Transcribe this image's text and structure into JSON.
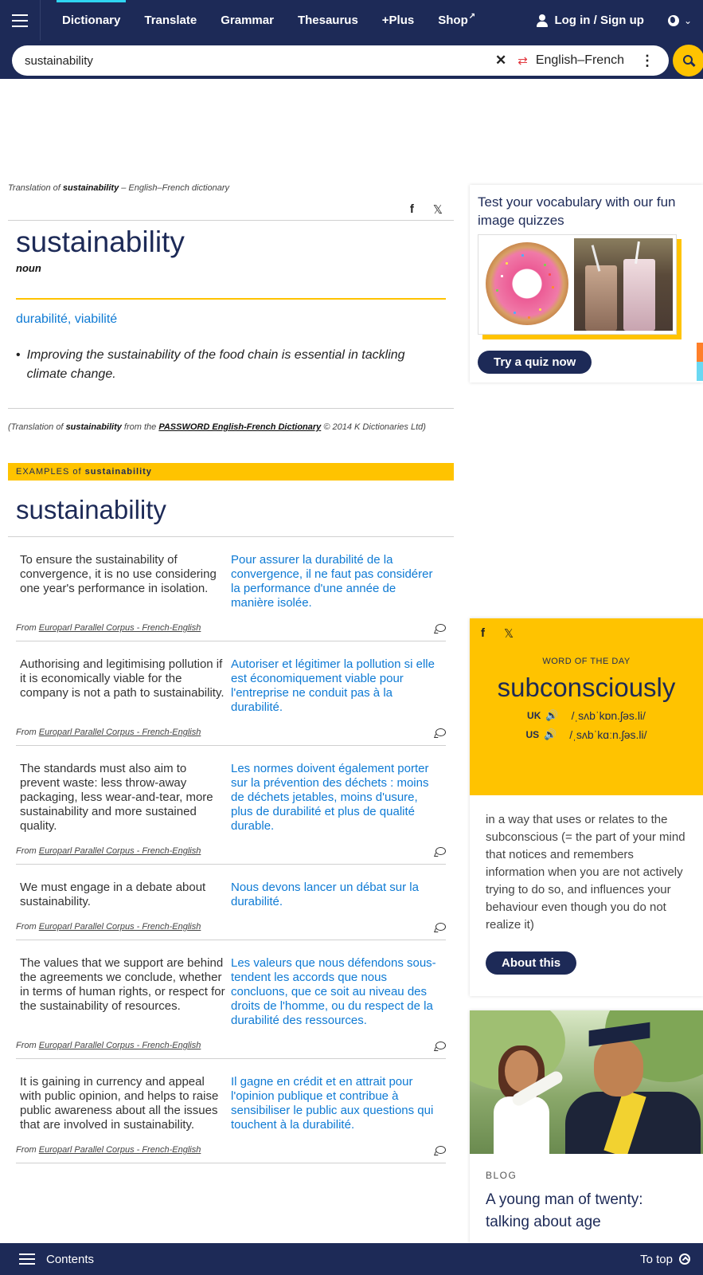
{
  "nav": {
    "items": [
      {
        "label": "Dictionary",
        "active": true
      },
      {
        "label": "Translate"
      },
      {
        "label": "Grammar"
      },
      {
        "label": "Thesaurus"
      },
      {
        "label": "+Plus"
      },
      {
        "label": "Shop"
      }
    ],
    "login_label": "Log in / Sign up",
    "icons": {
      "menu": "hamburger-icon",
      "user": "user-icon",
      "globe": "globe-icon",
      "external": "external-link-icon"
    }
  },
  "search": {
    "value": "sustainability",
    "language": "English–French",
    "icons": {
      "clear": "close-icon",
      "swap": "swap-icon",
      "more": "more-icon",
      "search": "search-icon"
    }
  },
  "entry": {
    "crumb_prefix": "Translation of",
    "crumb_word": "sustainability",
    "crumb_suffix": "– English–French dictionary",
    "headword": "sustainability",
    "pos": "noun",
    "translation": "durabilité, viabilité",
    "example_bullet": "•",
    "example": "Improving the sustainability of the food chain is essential in tackling climate change.",
    "credit_prefix": "(Translation of",
    "credit_word": "sustainability",
    "credit_mid": "from the",
    "credit_source": "PASSWORD English-French Dictionary",
    "credit_suffix": "© 2014 K Dictionaries Ltd)"
  },
  "examples": {
    "bar_prefix": "EXAMPLES of",
    "bar_word": "sustainability",
    "heading": "sustainability",
    "source_prefix": "From",
    "source_name": "Europarl Parallel Corpus - French-English",
    "rows": [
      {
        "en": "To ensure the sustainability of convergence, it is no use considering one year's performance in isolation.",
        "fr": "Pour assurer la durabilité de la convergence, il ne faut pas considérer la performance d'une année de manière isolée."
      },
      {
        "en": "Authorising and legitimising pollution if it is economically viable for the company is not a path to sustainability.",
        "fr": "Autoriser et légitimer la pollution si elle est économiquement viable pour l'entreprise ne conduit pas à la durabilité."
      },
      {
        "en": "The standards must also aim to prevent waste: less throw-away packaging, less wear-and-tear, more sustainability and more sustained quality.",
        "fr": "Les normes doivent également porter sur la prévention des déchets : moins de déchets jetables, moins d'usure, plus de durabilité et plus de qualité durable."
      },
      {
        "en": "We must engage in a debate about sustainability.",
        "fr": "Nous devons lancer un débat sur la durabilité."
      },
      {
        "en": "The values that we support are behind the agreements we conclude, whether in terms of human rights, or respect for the sustainability of resources.",
        "fr": "Les valeurs que nous défendons sous-tendent les accords que nous concluons, que ce soit au niveau des droits de l'homme, ou du respect de la durabilité des ressources."
      },
      {
        "en": "It is gaining in currency and appeal with public opinion, and helps to raise public awareness about all the issues that are involved in sustainability.",
        "fr": "Il gagne en crédit et en attrait pour l'opinion publique et contribue à sensibiliser le public aux questions qui touchent à la durabilité."
      }
    ]
  },
  "quiz": {
    "title": "Test your vocabulary with our fun image quizzes",
    "button": "Try a quiz now"
  },
  "wotd": {
    "label": "WORD OF THE DAY",
    "word": "subconsciously",
    "uk_label": "UK",
    "uk_ipa": "/ˌsʌbˈkɒn.ʃəs.li/",
    "us_label": "US",
    "us_ipa": "/ˌsʌbˈkɑːn.ʃəs.li/",
    "definition": "in a way that uses or relates to the subconscious (= the part of your mind that notices and remembers information when you are not actively trying to do so, and influences your behaviour even though you do not realize it)",
    "button": "About this"
  },
  "blog": {
    "tag": "BLOG",
    "title": "A young man of twenty: talking about age"
  },
  "bottom": {
    "contents": "Contents",
    "to_top": "To top"
  },
  "colors": {
    "navy": "#1d2a57",
    "yellow": "#ffc300",
    "link_blue": "#0e7ad4"
  }
}
